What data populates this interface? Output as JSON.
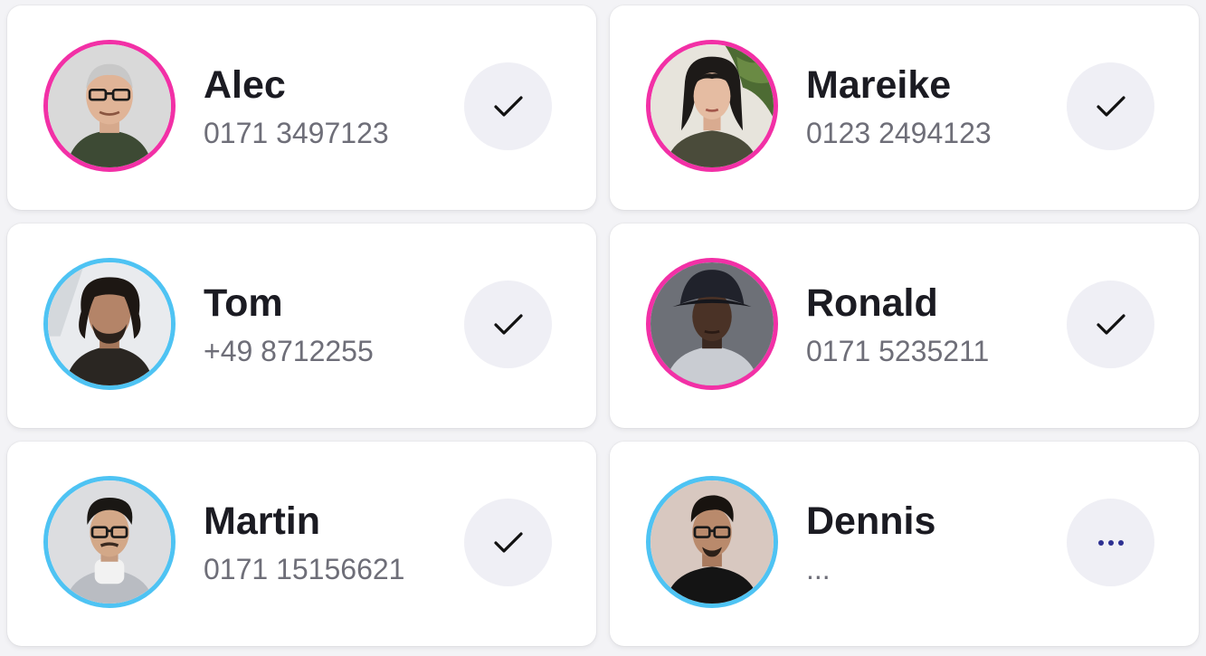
{
  "contacts": [
    {
      "name": "Alec",
      "phone": "0171 3497123",
      "ring_color": "#f230a6",
      "status": "confirmed",
      "status_icon": "check-icon"
    },
    {
      "name": "Mareike",
      "phone": "0123 2494123",
      "ring_color": "#f230a6",
      "status": "confirmed",
      "status_icon": "check-icon"
    },
    {
      "name": "Tom",
      "phone": "+49 8712255",
      "ring_color": "#4ec3f3",
      "status": "confirmed",
      "status_icon": "check-icon"
    },
    {
      "name": "Ronald",
      "phone": "0171 5235211",
      "ring_color": "#f230a6",
      "status": "confirmed",
      "status_icon": "check-icon"
    },
    {
      "name": "Martin",
      "phone": "0171 15156621",
      "ring_color": "#4ec3f3",
      "status": "confirmed",
      "status_icon": "check-icon"
    },
    {
      "name": "Dennis",
      "phone": "...",
      "ring_color": "#4ec3f3",
      "status": "pending",
      "status_icon": "more-dots-icon"
    }
  ],
  "colors": {
    "ring_pink": "#f230a6",
    "ring_blue": "#4ec3f3",
    "pending_dots": "#2e3192",
    "action_bg": "#efeff5"
  }
}
